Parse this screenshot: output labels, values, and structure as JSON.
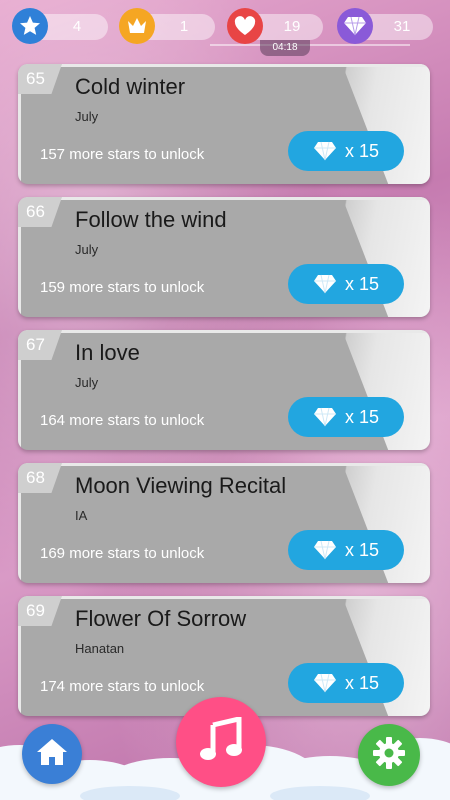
{
  "status": {
    "stars": "4",
    "crowns": "1",
    "lives": "19",
    "diamonds": "31",
    "timer": "04:18"
  },
  "colors": {
    "star_circle": "#2f80d8",
    "crown_circle": "#f5a623",
    "heart_circle": "#e84545",
    "diamond_circle": "#8a5ad8",
    "buy_button": "#22a6e0",
    "home_button": "#3a7fd6",
    "music_button": "#ff4f86",
    "settings_button": "#49b949"
  },
  "songs": [
    {
      "num": "65",
      "title": "Cold winter",
      "artist": "July",
      "unlock": "157 more stars to unlock",
      "price": "x 15"
    },
    {
      "num": "66",
      "title": "Follow the wind",
      "artist": "July",
      "unlock": "159 more stars to unlock",
      "price": "x 15"
    },
    {
      "num": "67",
      "title": "In love",
      "artist": "July",
      "unlock": "164 more stars to unlock",
      "price": "x 15"
    },
    {
      "num": "68",
      "title": "Moon Viewing Recital",
      "artist": "IA",
      "unlock": "169 more stars to unlock",
      "price": "x 15"
    },
    {
      "num": "69",
      "title": "Flower Of Sorrow",
      "artist": "Hanatan",
      "unlock": "174 more stars to unlock",
      "price": "x 15"
    }
  ],
  "icons": {
    "star": "star-icon",
    "crown": "crown-icon",
    "heart": "heart-icon",
    "diamond": "diamond-icon",
    "home": "home-icon",
    "music": "music-note-icon",
    "settings": "gear-icon"
  }
}
